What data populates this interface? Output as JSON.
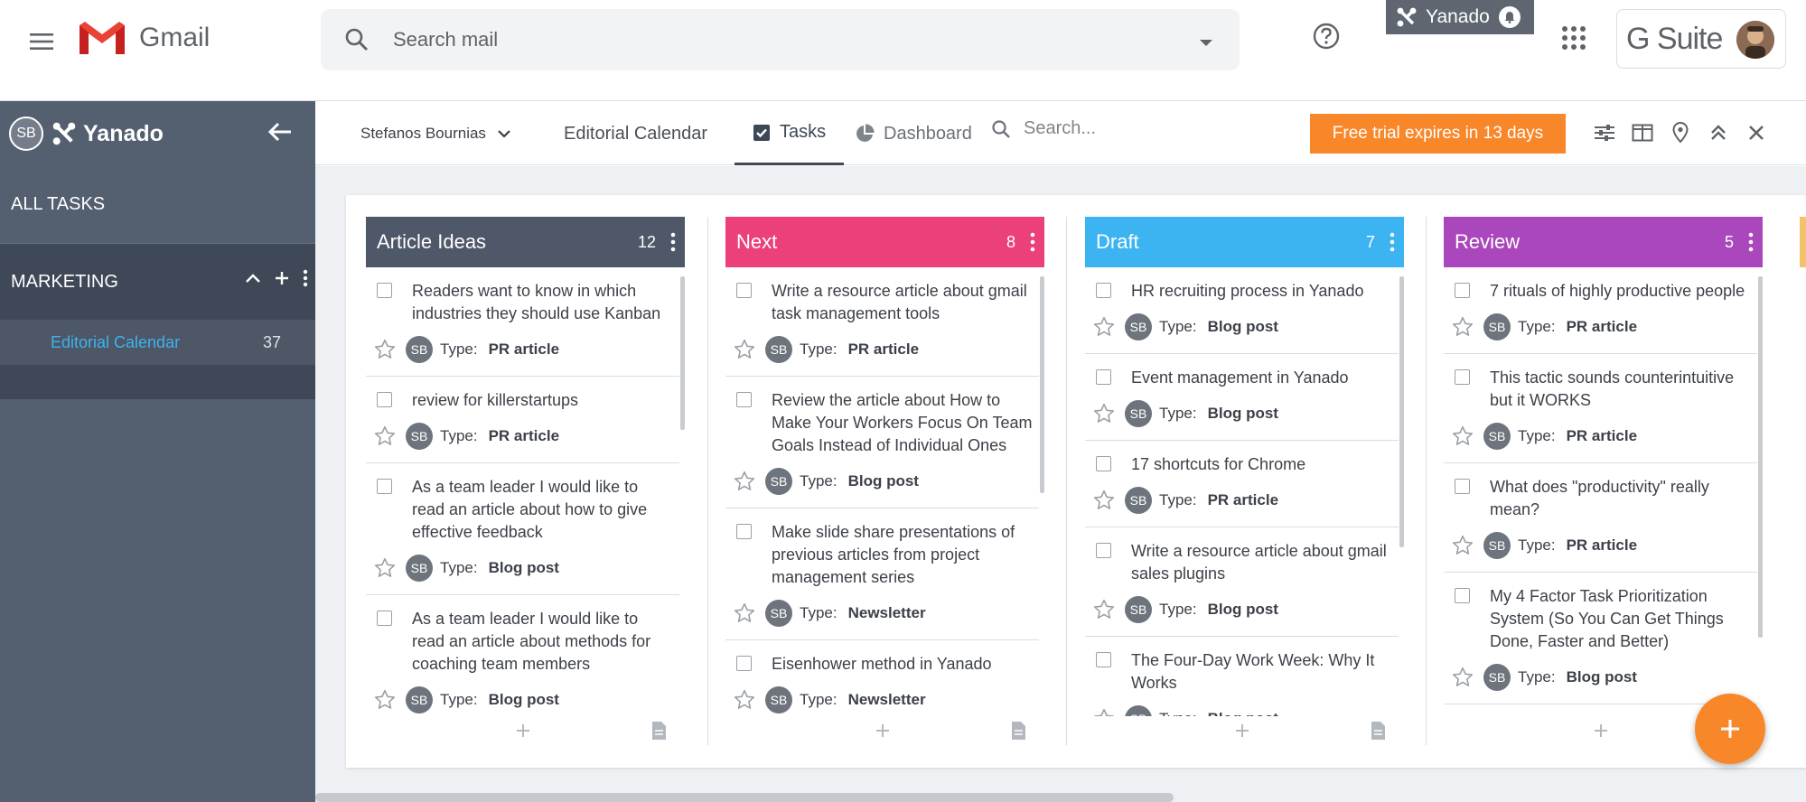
{
  "gmail": {
    "brand": "Gmail",
    "search_placeholder": "Search mail",
    "yanado_badge": "Yanado",
    "suite_label": "G Suite"
  },
  "sidebar": {
    "avatar": "SB",
    "brand": "Yanado",
    "all_tasks": "ALL TASKS",
    "section": "MARKETING",
    "list_name": "Editorial Calendar",
    "list_count": "37"
  },
  "topbar": {
    "user": "Stefanos Bournias",
    "tabs": [
      "Editorial Calendar",
      "Tasks",
      "Dashboard"
    ],
    "search_placeholder": "Search...",
    "trial": "Free trial expires in 13 days"
  },
  "colors": {
    "accent": "#f8872a",
    "article_ideas": "#4f5868",
    "next": "#ec407a",
    "draft": "#3cb4f2",
    "review": "#ab47bc"
  },
  "columns": [
    {
      "name": "Article Ideas",
      "count": "12",
      "color": "#4f5868",
      "cards": [
        {
          "title": "Readers want to know in which industries they should use Kanban",
          "type_label": "Type:",
          "type": "PR article",
          "avatar": "SB"
        },
        {
          "title": "review for killerstartups",
          "type_label": "Type:",
          "type": "PR article",
          "avatar": "SB"
        },
        {
          "title": "As a team leader I would like to read an article about how to give effective feedback",
          "type_label": "Type:",
          "type": "Blog post",
          "avatar": "SB"
        },
        {
          "title": "As a team leader I would like to read an article about methods for coaching team members",
          "type_label": "Type:",
          "type": "Blog post",
          "avatar": "SB"
        }
      ]
    },
    {
      "name": "Next",
      "count": "8",
      "color": "#ec407a",
      "cards": [
        {
          "title": "Write a resource article about gmail task management tools",
          "type_label": "Type:",
          "type": "PR article",
          "avatar": "SB"
        },
        {
          "title": "Review the article about How to Make Your Workers Focus On Team Goals Instead of Individual Ones",
          "type_label": "Type:",
          "type": "Blog post",
          "avatar": "SB"
        },
        {
          "title": "Make slide share presentations of previous articles from project management series",
          "type_label": "Type:",
          "type": "Newsletter",
          "avatar": "SB"
        },
        {
          "title": "Eisenhower method in Yanado",
          "type_label": "Type:",
          "type": "Newsletter",
          "avatar": "SB"
        }
      ]
    },
    {
      "name": "Draft",
      "count": "7",
      "color": "#3cb4f2",
      "cards": [
        {
          "title": "HR recruiting process in Yanado",
          "type_label": "Type:",
          "type": "Blog post",
          "avatar": "SB"
        },
        {
          "title": "Event management in Yanado",
          "type_label": "Type:",
          "type": "Blog post",
          "avatar": "SB"
        },
        {
          "title": "17 shortcuts for Chrome",
          "type_label": "Type:",
          "type": "PR article",
          "avatar": "SB"
        },
        {
          "title": "Write a resource article about gmail sales plugins",
          "type_label": "Type:",
          "type": "Blog post",
          "avatar": "SB"
        },
        {
          "title": "The Four-Day Work Week: Why It Works",
          "type_label": "Type:",
          "type": "Blog post",
          "avatar": "SB"
        }
      ]
    },
    {
      "name": "Review",
      "count": "5",
      "color": "#ab47bc",
      "cards": [
        {
          "title": "7 rituals of highly productive people",
          "type_label": "Type:",
          "type": "PR article",
          "avatar": "SB"
        },
        {
          "title": "This tactic sounds counterintuitive but it WORKS",
          "type_label": "Type:",
          "type": "PR article",
          "avatar": "SB"
        },
        {
          "title": "What does \"productivity\" really mean?",
          "type_label": "Type:",
          "type": "PR article",
          "avatar": "SB"
        },
        {
          "title": "My 4 Factor Task Prioritization System (So You Can Get Things Done, Faster and Better)",
          "type_label": "Type:",
          "type": "Blog post",
          "avatar": "SB"
        }
      ]
    }
  ]
}
